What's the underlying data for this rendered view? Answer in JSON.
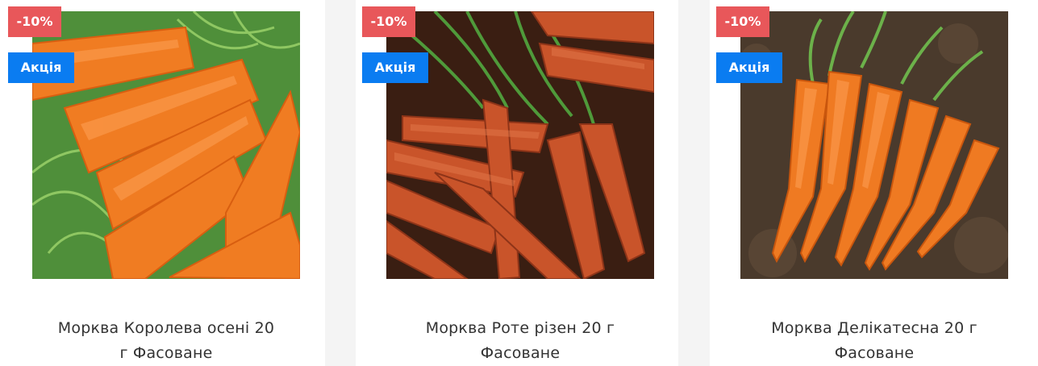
{
  "products": [
    {
      "discount_badge": "-10%",
      "promo_badge": "Акція",
      "title_line1": "Морква Королева осені 20",
      "title_line2": "г Фасоване",
      "image": "carrots-on-grass-photo"
    },
    {
      "discount_badge": "-10%",
      "promo_badge": "Акція",
      "title_line1": "Морква Роте різен 20 г",
      "title_line2": "Фасоване",
      "image": "carrot-bunches-photo"
    },
    {
      "discount_badge": "-10%",
      "promo_badge": "Акція",
      "title_line1": "Морква Делікатесна 20 г",
      "title_line2": "Фасоване",
      "image": "carrots-on-soil-photo"
    }
  ],
  "colors": {
    "discount_badge": "#e8575a",
    "promo_badge": "#0a7cf1",
    "title_text": "#333333"
  }
}
